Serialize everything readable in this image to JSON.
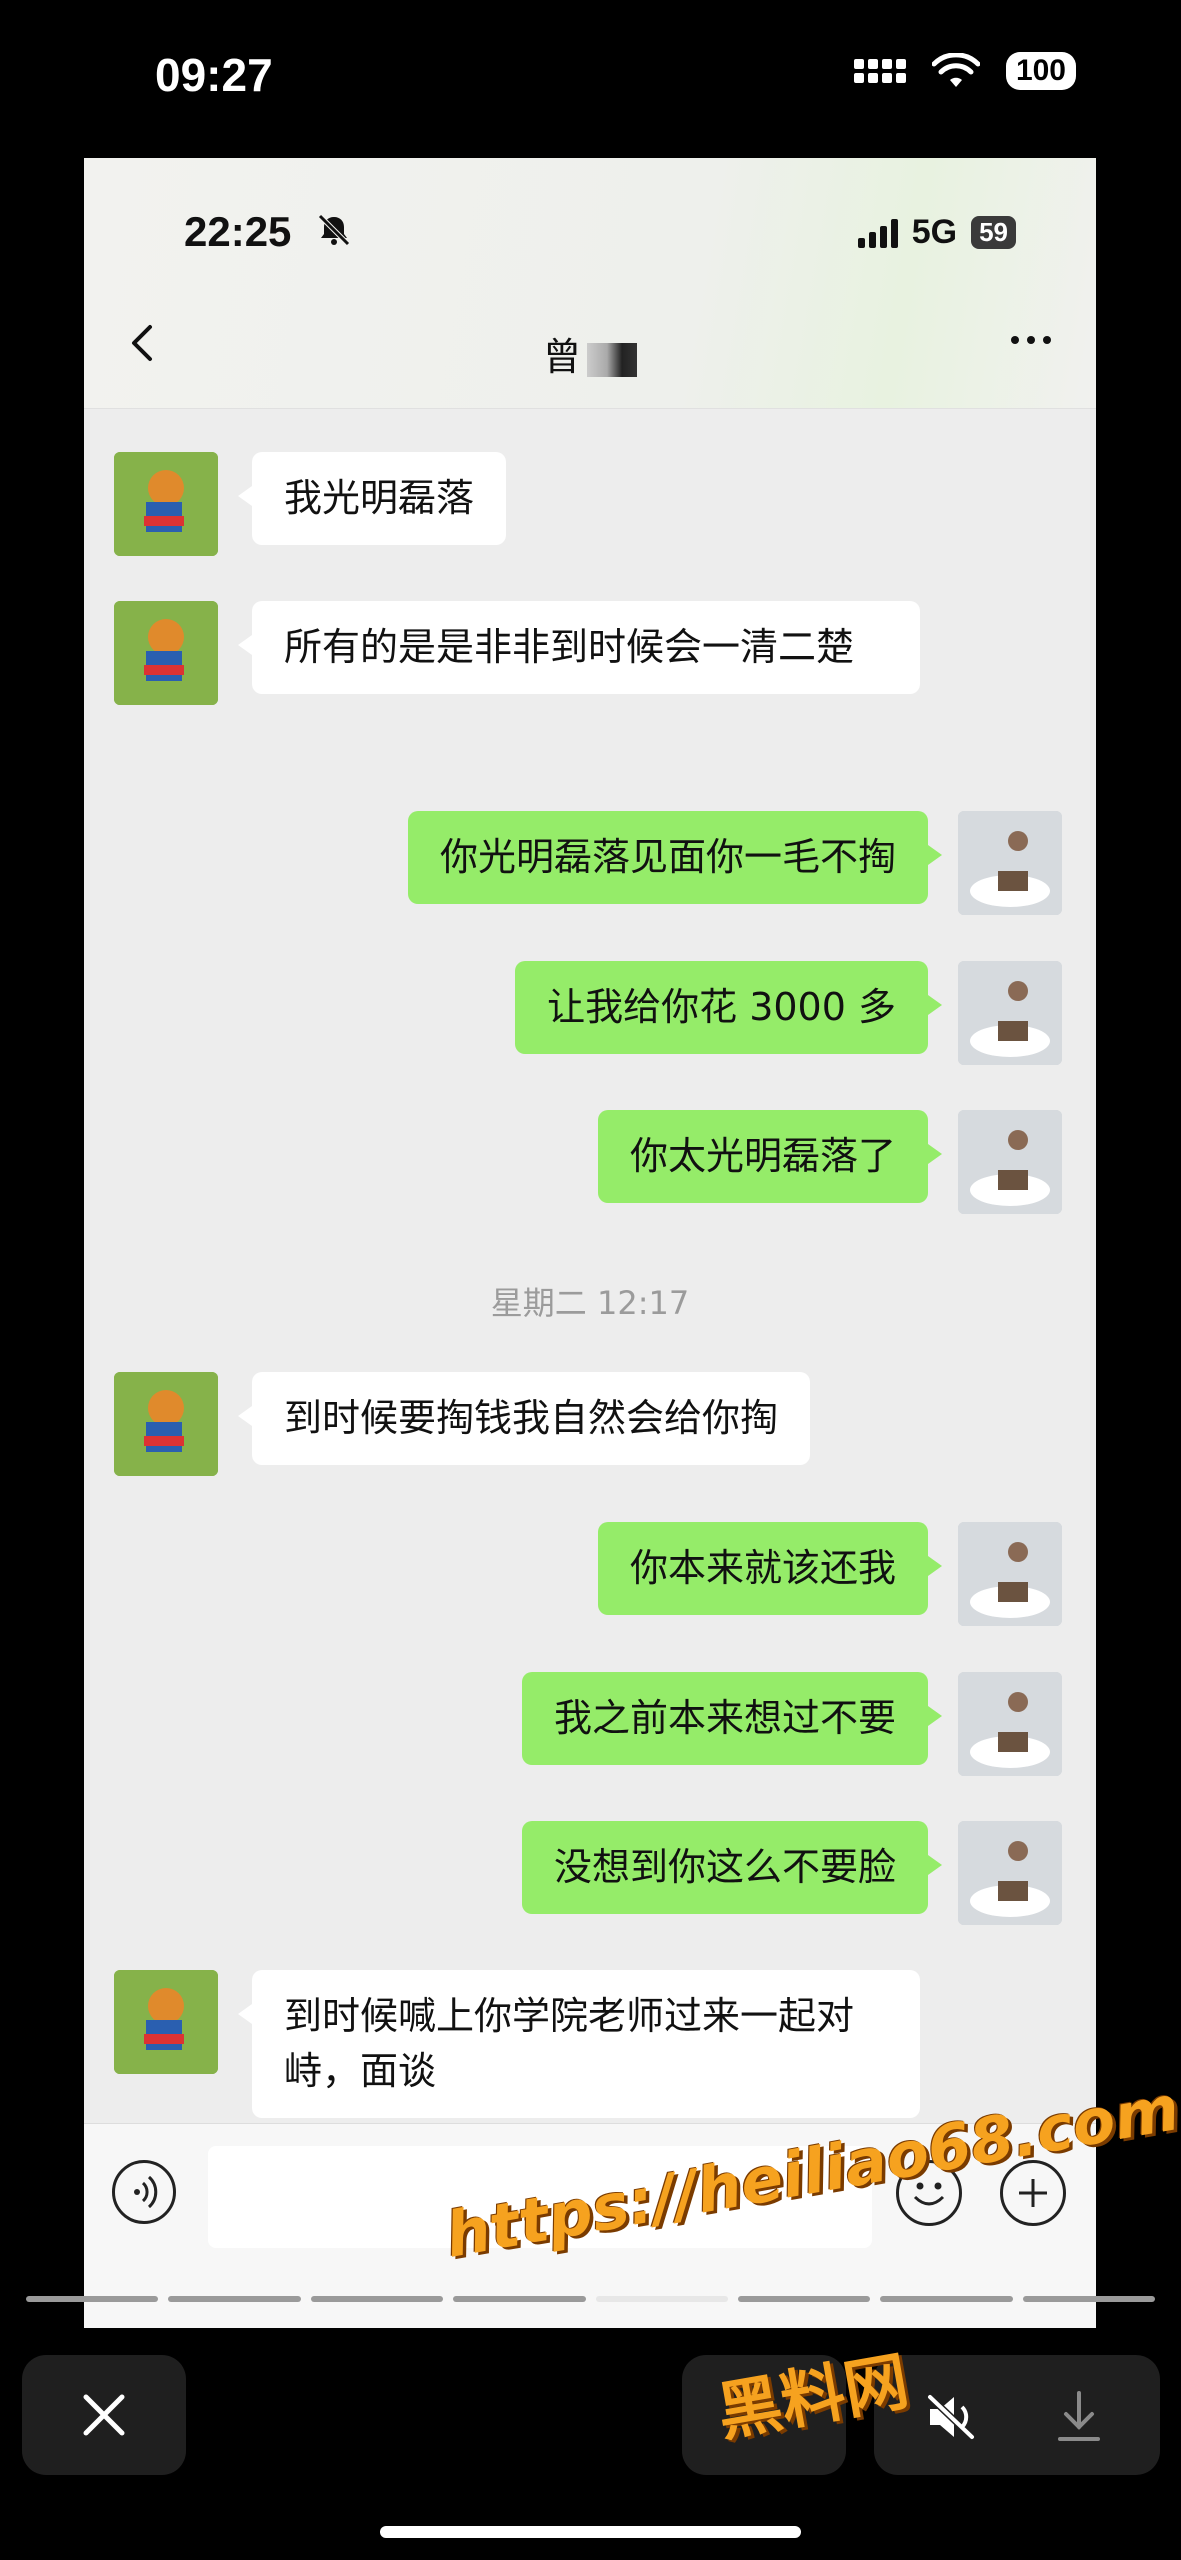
{
  "outer_status": {
    "time": "09:27",
    "battery": "100"
  },
  "chat": {
    "status_time": "22:25",
    "network": "5G",
    "battery": "59",
    "title": "曾"
  },
  "messages": [
    {
      "side": "other",
      "text": "我光明磊落"
    },
    {
      "side": "other",
      "text": "所有的是是非非到时候会一清二楚"
    },
    {
      "side": "me",
      "text": "你光明磊落见面你一毛不掏"
    },
    {
      "side": "me",
      "text": "让我给你花 3000 多"
    },
    {
      "side": "me",
      "text": "你太光明磊落了"
    },
    {
      "side": "other",
      "text": "到时候要掏钱我自然会给你掏"
    },
    {
      "side": "me",
      "text": "你本来就该还我"
    },
    {
      "side": "me",
      "text": "我之前本来想过不要"
    },
    {
      "side": "me",
      "text": "没想到你这么不要脸"
    },
    {
      "side": "other",
      "text": "到时候喊上你学院老师过来一起对峙，面谈"
    }
  ],
  "timestamp": "星期二 12:17",
  "watermark": {
    "url": "https://heiliao68.com",
    "name": "黑料网"
  },
  "icons": {
    "voice": "voice-icon",
    "emoji": "emoji-icon",
    "plus": "plus-icon",
    "close": "close-icon",
    "mute": "mute-icon",
    "download": "download-icon"
  }
}
